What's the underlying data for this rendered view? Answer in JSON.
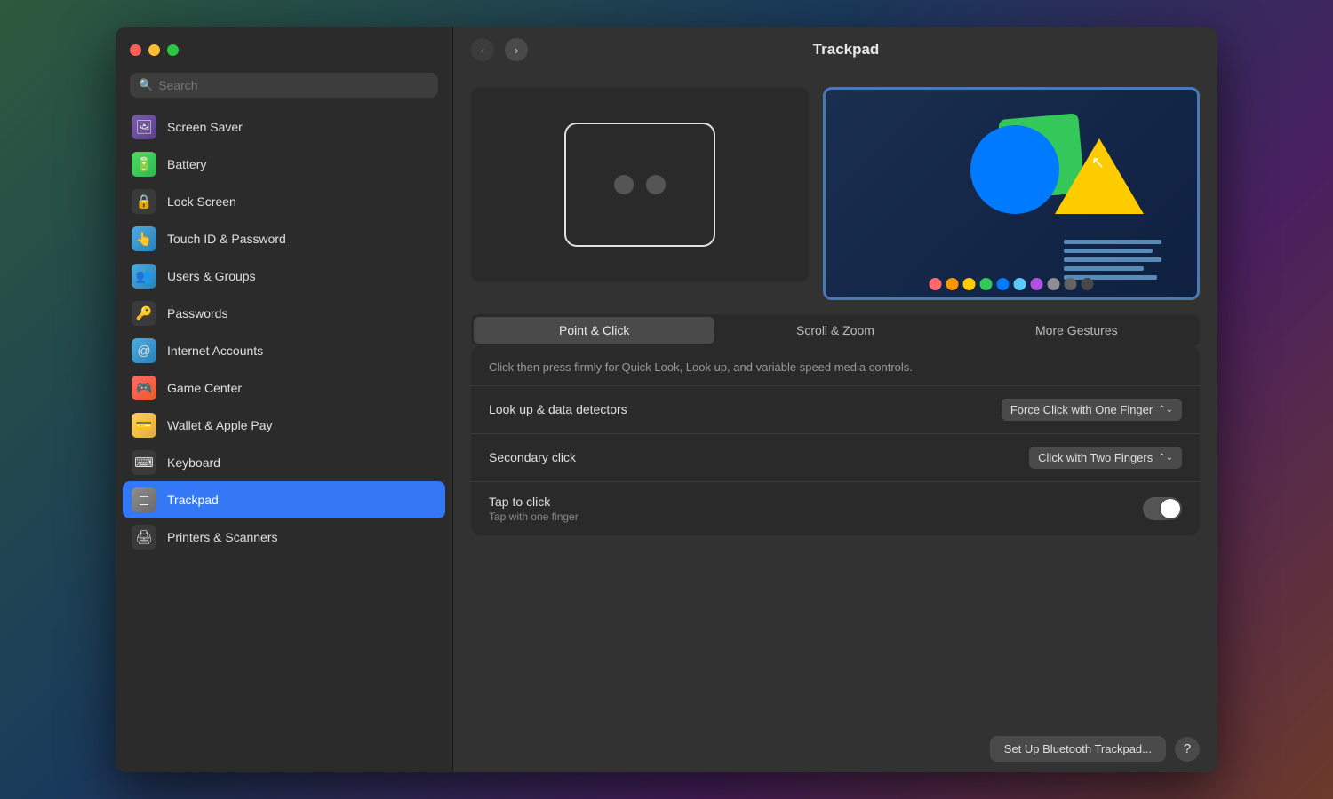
{
  "window": {
    "title": "Trackpad"
  },
  "sidebar": {
    "search_placeholder": "Search",
    "items": [
      {
        "id": "screen-saver",
        "label": "Screen Saver",
        "icon": "🖼",
        "icon_class": "icon-purple"
      },
      {
        "id": "battery",
        "label": "Battery",
        "icon": "🔋",
        "icon_class": "icon-green"
      },
      {
        "id": "lock-screen",
        "label": "Lock Screen",
        "icon": "🔒",
        "icon_class": "icon-dark"
      },
      {
        "id": "touch-id",
        "label": "Touch ID & Password",
        "icon": "👆",
        "icon_class": "icon-blue"
      },
      {
        "id": "users-groups",
        "label": "Users & Groups",
        "icon": "👥",
        "icon_class": "icon-blue"
      },
      {
        "id": "passwords",
        "label": "Passwords",
        "icon": "🔑",
        "icon_class": "icon-dark"
      },
      {
        "id": "internet-accounts",
        "label": "Internet Accounts",
        "icon": "@",
        "icon_class": "icon-blue"
      },
      {
        "id": "game-center",
        "label": "Game Center",
        "icon": "🎮",
        "icon_class": "icon-game"
      },
      {
        "id": "wallet",
        "label": "Wallet & Apple Pay",
        "icon": "💳",
        "icon_class": "icon-wallet"
      },
      {
        "id": "keyboard",
        "label": "Keyboard",
        "icon": "⌨",
        "icon_class": "icon-keyboard"
      },
      {
        "id": "trackpad",
        "label": "Trackpad",
        "icon": "◻",
        "icon_class": "icon-trackpad",
        "active": true
      },
      {
        "id": "printers",
        "label": "Printers & Scanners",
        "icon": "🖨",
        "icon_class": "icon-printer"
      }
    ]
  },
  "main": {
    "nav": {
      "back_disabled": true,
      "forward_disabled": false
    },
    "tabs": [
      {
        "id": "point-click",
        "label": "Point & Click",
        "active": true
      },
      {
        "id": "scroll-zoom",
        "label": "Scroll & Zoom",
        "active": false
      },
      {
        "id": "more-gestures",
        "label": "More Gestures",
        "active": false
      }
    ],
    "desc_text": "Click then press firmly for Quick Look, Look up, and variable speed media controls.",
    "settings": [
      {
        "id": "lookup",
        "label": "Look up & data detectors",
        "sublabel": "",
        "control_type": "dropdown",
        "value": "Force Click with One Finger"
      },
      {
        "id": "secondary-click",
        "label": "Secondary click",
        "sublabel": "",
        "control_type": "dropdown",
        "value": "Click with Two Fingers"
      },
      {
        "id": "tap-to-click",
        "label": "Tap to click",
        "sublabel": "Tap with one finger",
        "control_type": "toggle",
        "value": false
      }
    ],
    "bottom": {
      "setup_btn": "Set Up Bluetooth Trackpad...",
      "help_btn": "?"
    }
  },
  "color_dots": [
    "#ff6b6b",
    "#ff9500",
    "#ffcc00",
    "#34c759",
    "#007aff",
    "#5ac8fa",
    "#af52de",
    "#8e8e93",
    "#636366",
    "#48484a"
  ]
}
